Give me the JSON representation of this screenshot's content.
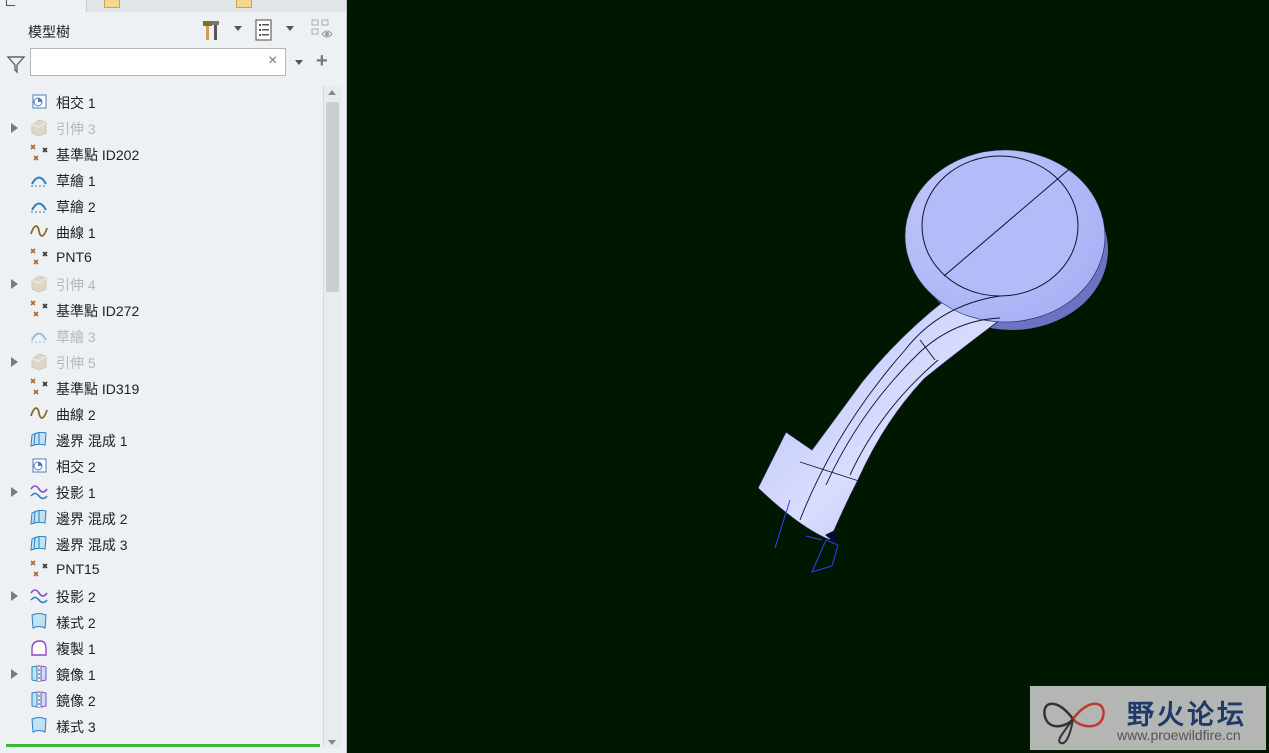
{
  "panel": {
    "title": "模型樹",
    "search": {
      "value": "",
      "placeholder": ""
    },
    "clear_glyph": "×",
    "add_glyph": "+"
  },
  "tree_items": [
    {
      "label": "相交 1",
      "icon": "intersect-icon",
      "expandable": false,
      "dimmed": false
    },
    {
      "label": "引伸 3",
      "icon": "extrude-icon",
      "expandable": true,
      "dimmed": true
    },
    {
      "label": "基準點 ID202",
      "icon": "datum-point-icon",
      "expandable": false,
      "dimmed": false
    },
    {
      "label": "草繪 1",
      "icon": "sketch-icon",
      "expandable": false,
      "dimmed": false
    },
    {
      "label": "草繪 2",
      "icon": "sketch-icon",
      "expandable": false,
      "dimmed": false
    },
    {
      "label": "曲線 1",
      "icon": "curve-icon",
      "expandable": false,
      "dimmed": false
    },
    {
      "label": "PNT6",
      "icon": "datum-point-icon",
      "expandable": false,
      "dimmed": false
    },
    {
      "label": "引伸 4",
      "icon": "extrude-icon",
      "expandable": true,
      "dimmed": true
    },
    {
      "label": "基準點 ID272",
      "icon": "datum-point-icon",
      "expandable": false,
      "dimmed": false
    },
    {
      "label": "草繪 3",
      "icon": "sketch-icon",
      "expandable": false,
      "dimmed": true
    },
    {
      "label": "引伸 5",
      "icon": "extrude-icon",
      "expandable": true,
      "dimmed": true
    },
    {
      "label": "基準點 ID319",
      "icon": "datum-point-icon",
      "expandable": false,
      "dimmed": false
    },
    {
      "label": "曲線 2",
      "icon": "curve-icon",
      "expandable": false,
      "dimmed": false
    },
    {
      "label": "邊界 混成 1",
      "icon": "boundary-blend-icon",
      "expandable": false,
      "dimmed": false
    },
    {
      "label": "相交 2",
      "icon": "intersect-icon",
      "expandable": false,
      "dimmed": false
    },
    {
      "label": "投影 1",
      "icon": "projection-icon",
      "expandable": true,
      "dimmed": false
    },
    {
      "label": "邊界 混成 2",
      "icon": "boundary-blend-icon",
      "expandable": false,
      "dimmed": false
    },
    {
      "label": "邊界 混成 3",
      "icon": "boundary-blend-icon",
      "expandable": false,
      "dimmed": false
    },
    {
      "label": "PNT15",
      "icon": "datum-point-icon",
      "expandable": false,
      "dimmed": false
    },
    {
      "label": "投影 2",
      "icon": "projection-icon",
      "expandable": true,
      "dimmed": false
    },
    {
      "label": "樣式 2",
      "icon": "style-icon",
      "expandable": false,
      "dimmed": false
    },
    {
      "label": "複製 1",
      "icon": "copy-icon",
      "expandable": false,
      "dimmed": false
    },
    {
      "label": "鏡像 1",
      "icon": "mirror-icon",
      "expandable": true,
      "dimmed": false
    },
    {
      "label": "鏡像 2",
      "icon": "mirror-icon",
      "expandable": false,
      "dimmed": false
    },
    {
      "label": "樣式 3",
      "icon": "style-icon",
      "expandable": false,
      "dimmed": false
    }
  ],
  "watermark": {
    "title": "野火论坛",
    "url": "www.proewildfire.cn"
  },
  "colors": {
    "viewport_bg": "#001800",
    "model_fill": "#aab4f6",
    "model_shadow": "#6f78c8",
    "panel_bg": "#eef1f4"
  }
}
